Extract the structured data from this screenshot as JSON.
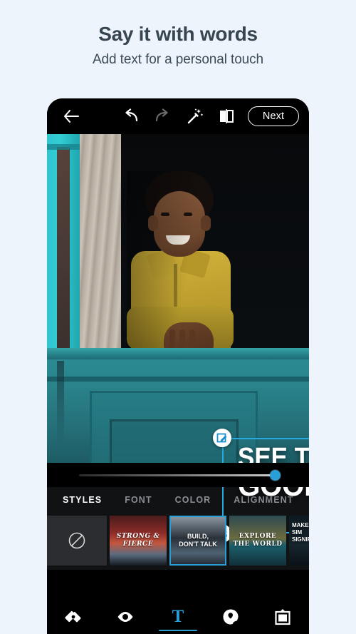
{
  "promo": {
    "title": "Say it with words",
    "subtitle": "Add text for a personal touch"
  },
  "colors": {
    "background": "#eef4fc",
    "accent": "#2a9fd6",
    "selection": "#26a8e0",
    "phone": "#000000",
    "text_dark": "#36454f"
  },
  "toolbar": {
    "back_icon": "back-arrow-icon",
    "undo_icon": "undo-icon",
    "redo_icon": "redo-icon",
    "magic_icon": "magic-wand-icon",
    "compare_icon": "compare-before-after-icon",
    "next_label": "Next"
  },
  "canvas": {
    "photo_description": "Smiling boy in a yellow shirt leaning out of a teal painted window",
    "overlay_text": {
      "line1": "SEE THE",
      "line2": "GOOD"
    },
    "handles": [
      {
        "name": "edit-text-handle",
        "icon": "pencil-edit-icon"
      },
      {
        "name": "delete-text-handle",
        "icon": "close-x-icon"
      },
      {
        "name": "rotate-text-handle",
        "icon": "rotate-icon"
      },
      {
        "name": "resize-text-handle",
        "icon": "resize-diagonal-icon"
      }
    ]
  },
  "slider": {
    "name": "opacity-slider",
    "value": 100
  },
  "tabs": [
    {
      "label": "STYLES",
      "active": true
    },
    {
      "label": "FONT",
      "active": false
    },
    {
      "label": "COLOR",
      "active": false
    },
    {
      "label": "ALIGNMENT",
      "active": false
    }
  ],
  "styles": [
    {
      "id": "none",
      "label": "",
      "icon": "no-style-icon",
      "selected": false
    },
    {
      "id": "strong-fierce",
      "line1": "STRONG &",
      "line2": "FIERCE",
      "selected": false
    },
    {
      "id": "build-dont-talk",
      "line1": "BUILD,",
      "line2": "DON'T TALK",
      "selected": true
    },
    {
      "id": "explore-the-world",
      "line1": "EXPLORE",
      "line2": "THE WORLD",
      "selected": false
    },
    {
      "id": "make-it-significant",
      "line1": "MAKE IT SIM",
      "line2": "SIGNIFIC",
      "selected": false
    }
  ],
  "bottom_nav": [
    {
      "id": "heal",
      "icon": "healing-patch-icon",
      "active": false
    },
    {
      "id": "looks",
      "icon": "eye-icon",
      "active": false
    },
    {
      "id": "text",
      "icon": "text-t-icon",
      "label": "T",
      "active": true
    },
    {
      "id": "stickers",
      "icon": "sticker-blob-icon",
      "active": false
    },
    {
      "id": "frames",
      "icon": "frame-icon",
      "active": false
    }
  ]
}
